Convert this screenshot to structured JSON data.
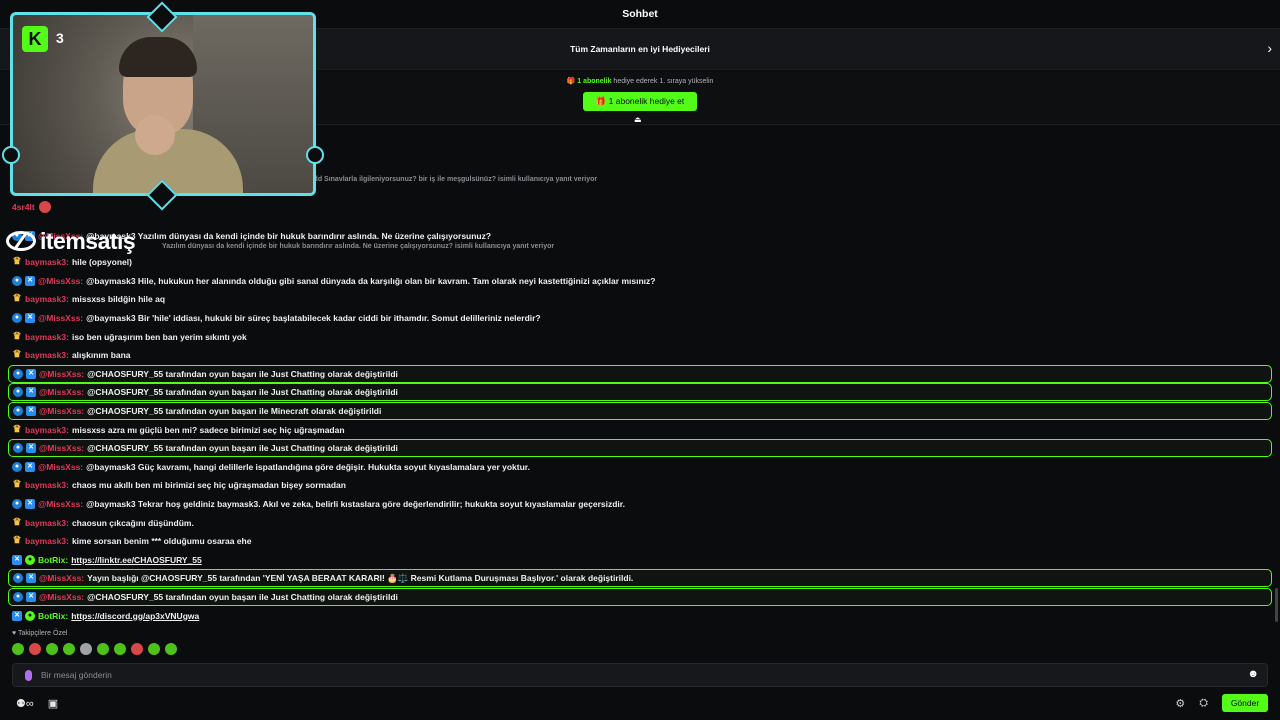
{
  "header": {
    "title": "Sohbet"
  },
  "gifters": {
    "label": "Tüm Zamanların en iyi Hediyecileri"
  },
  "promo": {
    "highlight": "1 abonelik",
    "rest": "hediye ederek 1. sıraya yükselin",
    "button": "1 abonelik hediye et"
  },
  "webcam": {
    "logo": "K",
    "count": "3"
  },
  "watermark": {
    "text": "itemsatış"
  },
  "faint_reply_1": "@rdd Sınavlarla ilgileniyorsunuz? bir iş ile meşgulsünüz? isimli kullanıcıya yanıt veriyor",
  "faint_reply_2": "Yazılım dünyası da kendi içinde bir hukuk barındırır aslında. Ne üzerine çalışıyorsunuz? isimli kullanıcıya yanıt veriyor",
  "messages": [
    {
      "user": "4sr4lt",
      "text": "",
      "badges": [],
      "color": "red",
      "hl": false,
      "emote": true
    },
    {
      "user": "@MissXss:",
      "text": "@baymask3 Yazılım dünyası da kendi içinde bir hukuk barındırır aslında. Ne üzerine çalışıyorsunuz?",
      "badges": [
        "bot",
        "mod"
      ],
      "color": "red",
      "hl": false
    },
    {
      "user": "baymask3:",
      "text": "hile (opsyonel)",
      "badges": [
        "crown"
      ],
      "color": "red",
      "hl": false
    },
    {
      "user": "@MissXss:",
      "text": "@baymask3 Hile, hukukun her alanında olduğu gibi sanal dünyada da karşılığı olan bir kavram. Tam olarak neyi kastettiğinizi açıklar mısınız?",
      "badges": [
        "bot",
        "mod"
      ],
      "color": "red",
      "hl": false
    },
    {
      "user": "baymask3:",
      "text": "missxss bildğin hile aq",
      "badges": [
        "crown"
      ],
      "color": "red",
      "hl": false
    },
    {
      "user": "@MissXss:",
      "text": "@baymask3 Bir 'hile' iddiası, hukuki bir süreç başlatabilecek kadar ciddi bir ithamdır. Somut delilleriniz nelerdir?",
      "badges": [
        "bot",
        "mod"
      ],
      "color": "red",
      "hl": false
    },
    {
      "user": "baymask3:",
      "text": "iso ben uğraşırım ben ban yerim sıkıntı yok",
      "badges": [
        "crown"
      ],
      "color": "red",
      "hl": false
    },
    {
      "user": "baymask3:",
      "text": "alışkınım bana",
      "badges": [
        "crown"
      ],
      "color": "red",
      "hl": false
    },
    {
      "user": "@MissXss:",
      "text": "@CHAOSFURY_55 tarafından oyun başarı ile Just Chatting olarak değiştirildi",
      "badges": [
        "bot",
        "mod"
      ],
      "color": "red",
      "hl": true
    },
    {
      "user": "@MissXss:",
      "text": "@CHAOSFURY_55 tarafından oyun başarı ile Just Chatting olarak değiştirildi",
      "badges": [
        "bot",
        "mod"
      ],
      "color": "red",
      "hl": true
    },
    {
      "user": "@MissXss:",
      "text": "@CHAOSFURY_55 tarafından oyun başarı ile Minecraft olarak değiştirildi",
      "badges": [
        "bot",
        "mod"
      ],
      "color": "red",
      "hl": true
    },
    {
      "user": "baymask3:",
      "text": "missxss azra mı güçlü ben mi? sadece birimizi seç hiç uğraşmadan",
      "badges": [
        "crown"
      ],
      "color": "red",
      "hl": false
    },
    {
      "user": "@MissXss:",
      "text": "@CHAOSFURY_55 tarafından oyun başarı ile Just Chatting olarak değiştirildi",
      "badges": [
        "bot",
        "mod"
      ],
      "color": "red",
      "hl": true
    },
    {
      "user": "@MissXss:",
      "text": "@baymask3 Güç kavramı, hangi delillerle ispatlandığına göre değişir. Hukukta soyut kıyaslamalara yer yoktur.",
      "badges": [
        "bot",
        "mod"
      ],
      "color": "red",
      "hl": false
    },
    {
      "user": "baymask3:",
      "text": "chaos mu akıllı ben mi birimizi seç hiç uğraşmadan bişey sormadan",
      "badges": [
        "crown"
      ],
      "color": "red",
      "hl": false
    },
    {
      "user": "@MissXss:",
      "text": "@baymask3 Tekrar hoş geldiniz baymask3. Akıl ve zeka, belirli kıstaslara göre değerlendirilir; hukukta soyut kıyaslamalar geçersizdir.",
      "badges": [
        "bot",
        "mod"
      ],
      "color": "red",
      "hl": false
    },
    {
      "user": "baymask3:",
      "text": "chaosun çıkcağını düşündüm.",
      "badges": [
        "crown"
      ],
      "color": "red",
      "hl": false
    },
    {
      "user": "baymask3:",
      "text": "kime sorsan benim *** olduğumu osaraa ehe",
      "badges": [
        "crown"
      ],
      "color": "red",
      "hl": false
    },
    {
      "user": "BotRix:",
      "text": "https://linktr.ee/CHAOSFURY_55",
      "badges": [
        "mod",
        "vip"
      ],
      "color": "green",
      "hl": false,
      "link": true
    },
    {
      "user": "@MissXss:",
      "text": "Yayın başlığı @CHAOSFURY_55 tarafından 'YENİ YAŞA BERAAT KARARI! 🎂⚖️ Resmi Kutlama Duruşması Başlıyor.' olarak değiştirildi.",
      "badges": [
        "bot",
        "mod"
      ],
      "color": "red",
      "hl": true
    },
    {
      "user": "@MissXss:",
      "text": "@CHAOSFURY_55 tarafından oyun başarı ile Just Chatting olarak değiştirildi",
      "badges": [
        "bot",
        "mod"
      ],
      "color": "red",
      "hl": true
    },
    {
      "user": "BotRix:",
      "text": "https://discord.gg/ap3xVNUgwa",
      "badges": [
        "mod",
        "vip"
      ],
      "color": "green",
      "hl": false,
      "link": true
    }
  ],
  "emotes": {
    "label": "Takipçilere Özel",
    "items": [
      "g",
      "r",
      "g",
      "g",
      "gray",
      "g",
      "g",
      "r",
      "g",
      "g"
    ]
  },
  "input": {
    "placeholder": "Bir mesaj gönderin"
  },
  "footer": {
    "send": "Gönder",
    "left_count": "∞"
  },
  "colors": {
    "accent": "#53fc18",
    "username_red": "#e3395a",
    "bg": "#0b0c0e"
  }
}
